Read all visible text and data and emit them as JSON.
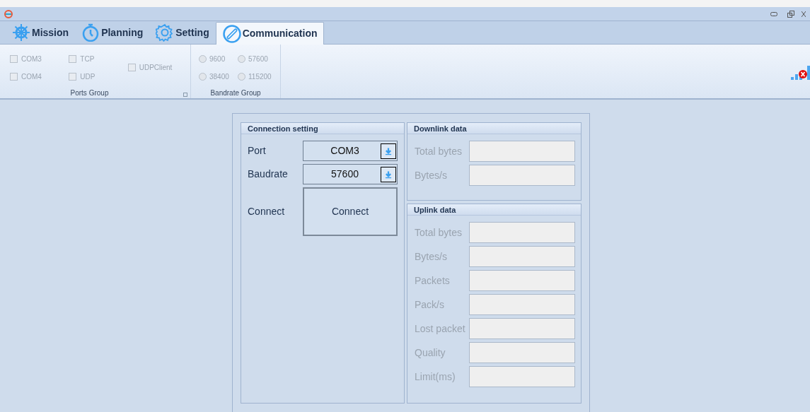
{
  "tabs": [
    {
      "label": "Mission",
      "selected": false
    },
    {
      "label": "Planning",
      "selected": false
    },
    {
      "label": "Setting",
      "selected": false
    },
    {
      "label": "Communication",
      "selected": true
    }
  ],
  "ports_group": {
    "title": "Ports Group",
    "columns": [
      [
        {
          "label": "COM3",
          "checked": false
        },
        {
          "label": "COM4",
          "checked": false
        }
      ],
      [
        {
          "label": "TCP",
          "checked": false
        },
        {
          "label": "UDP",
          "checked": false
        }
      ],
      [
        {
          "label": "UDPClient",
          "checked": false
        }
      ]
    ]
  },
  "bandrate_group": {
    "title": "Bandrate Group",
    "columns": [
      [
        {
          "label": "9600",
          "selected": false
        },
        {
          "label": "38400",
          "selected": false
        }
      ],
      [
        {
          "label": "57600",
          "selected": false
        },
        {
          "label": "115200",
          "selected": false
        }
      ]
    ]
  },
  "connection_setting": {
    "title": "Connection setting",
    "port_label": "Port",
    "port_value": "COM3",
    "baudrate_label": "Baudrate",
    "baudrate_value": "57600",
    "connect_label": "Connect",
    "connect_button": "Connect"
  },
  "downlink_data": {
    "title": "Downlink data",
    "fields": [
      "Total bytes",
      "Bytes/s"
    ]
  },
  "uplink_data": {
    "title": "Uplink data",
    "fields": [
      "Total bytes",
      "Bytes/s",
      "Packets",
      "Pack/s",
      "Lost packet",
      "Quality",
      "Limit(ms)"
    ]
  }
}
